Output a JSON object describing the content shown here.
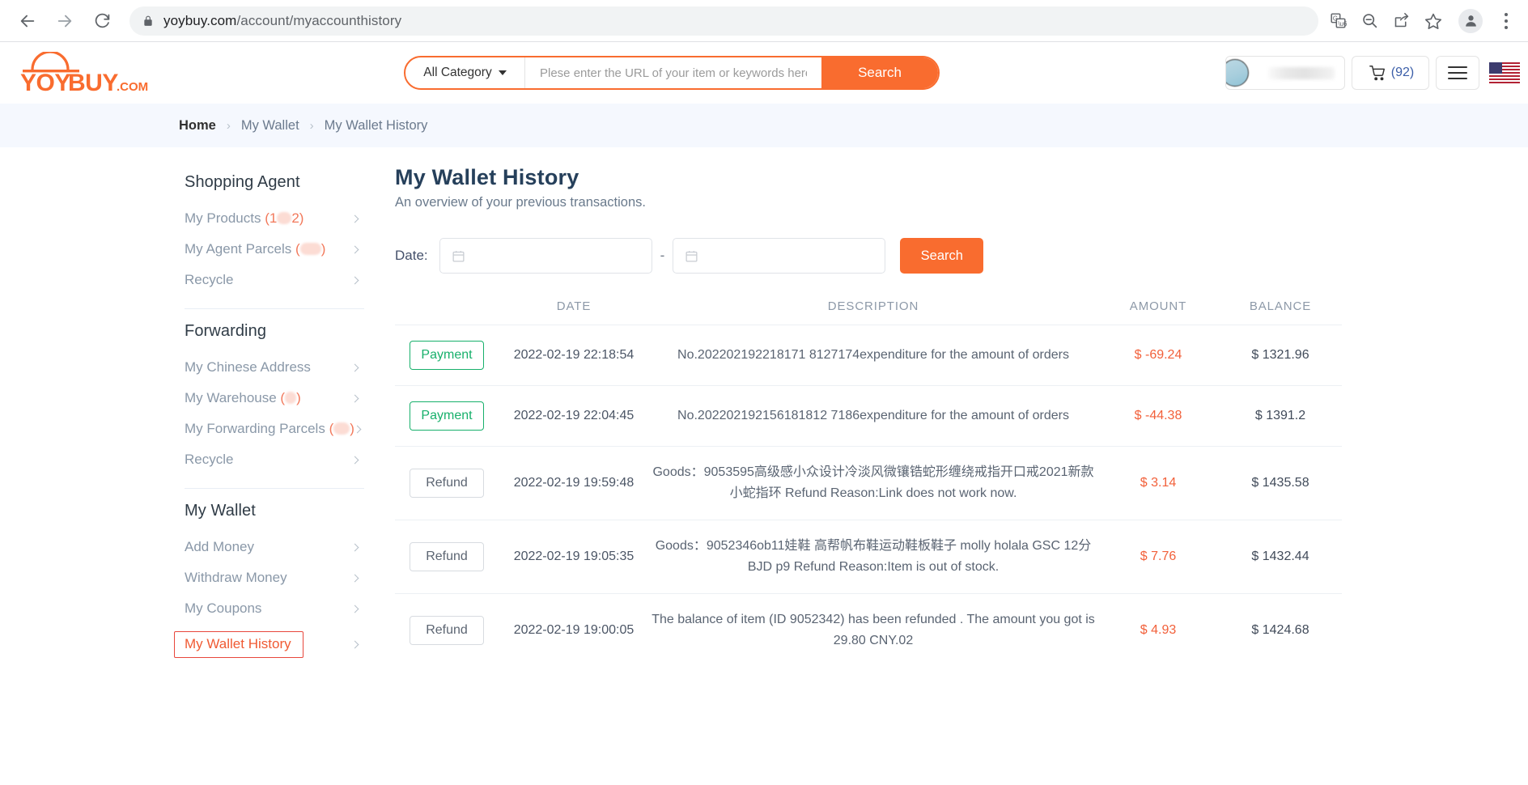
{
  "browser": {
    "url_domain": "yoybuy.com",
    "url_path": "/account/myaccounthistory",
    "back_icon": "back-arrow-icon",
    "forward_icon": "forward-arrow-icon",
    "reload_icon": "reload-icon",
    "lock_icon": "lock-icon",
    "translate_icon": "translate-icon",
    "zoom_out_icon": "zoom-out-icon",
    "share_icon": "share-icon",
    "bookmark_icon": "star-icon",
    "profile_icon": "profile-avatar-icon",
    "menu_icon": "kebab-menu-icon"
  },
  "header": {
    "logo_text": "YOYBUY.COM",
    "category_label": "All Category",
    "search_placeholder": "Plese enter the URL of your item or keywords here...",
    "search_value": "",
    "search_button": "Search",
    "cart_count": "(92)",
    "flag": "us-flag-icon",
    "account_name": ""
  },
  "breadcrumb": {
    "home": "Home",
    "parent": "My Wallet",
    "current": "My Wallet History",
    "separator": "›"
  },
  "sidebar": {
    "groups": [
      {
        "title": "Shopping Agent",
        "items": [
          {
            "label": "My Products",
            "count_prefix": "(1",
            "count_suffix": "2)",
            "redacted": true,
            "redact_w": 18,
            "active": false
          },
          {
            "label": "My Agent Parcels",
            "count_prefix": "(",
            "count_suffix": ")",
            "redacted": true,
            "redact_w": 26,
            "active": false
          },
          {
            "label": "Recycle",
            "count_prefix": "",
            "count_suffix": "",
            "redacted": false,
            "redact_w": 0,
            "active": false
          }
        ]
      },
      {
        "title": "Forwarding",
        "items": [
          {
            "label": "My Chinese Address",
            "count_prefix": "",
            "count_suffix": "",
            "redacted": false,
            "redact_w": 0,
            "active": false
          },
          {
            "label": "My Warehouse",
            "count_prefix": "(",
            "count_suffix": ")",
            "redacted": true,
            "redact_w": 14,
            "active": false
          },
          {
            "label": "My Forwarding Parcels",
            "count_prefix": "(",
            "count_suffix": ")",
            "redacted": true,
            "redact_w": 20,
            "active": false
          },
          {
            "label": "Recycle",
            "count_prefix": "",
            "count_suffix": "",
            "redacted": false,
            "redact_w": 0,
            "active": false
          }
        ]
      },
      {
        "title": "My Wallet",
        "items": [
          {
            "label": "Add Money",
            "count_prefix": "",
            "count_suffix": "",
            "redacted": false,
            "redact_w": 0,
            "active": false
          },
          {
            "label": "Withdraw Money",
            "count_prefix": "",
            "count_suffix": "",
            "redacted": false,
            "redact_w": 0,
            "active": false
          },
          {
            "label": "My Coupons",
            "count_prefix": "",
            "count_suffix": "",
            "redacted": false,
            "redact_w": 0,
            "active": false
          },
          {
            "label": "My Wallet History",
            "count_prefix": "",
            "count_suffix": "",
            "redacted": false,
            "redact_w": 0,
            "active": true
          }
        ]
      }
    ]
  },
  "main": {
    "title": "My Wallet History",
    "subtitle": "An overview of your previous transactions.",
    "filter": {
      "date_label": "Date:",
      "date_from_value": "",
      "date_to_value": "",
      "date_placeholder": "",
      "separator": "-",
      "search_button": "Search",
      "calendar_icon": "calendar-icon"
    },
    "table": {
      "columns": [
        "",
        "DATE",
        "DESCRIPTION",
        "AMOUNT",
        "BALANCE"
      ],
      "rows": [
        {
          "type": "Payment",
          "date": "2022-02-19 22:18:54",
          "description": "No.202202192218171 8127174expenditure for the amount of orders",
          "amount": "$ -69.24",
          "balance": "$ 1321.96"
        },
        {
          "type": "Payment",
          "date": "2022-02-19 22:04:45",
          "description": "No.202202192156181812 7186expenditure for the amount of orders",
          "amount": "$ -44.38",
          "balance": "$ 1391.2"
        },
        {
          "type": "Refund",
          "date": "2022-02-19 19:59:48",
          "description": "Goods：9053595高级感小众设计冷淡风微镶锆蛇形缠绕戒指开口戒2021新款小蛇指环 Refund Reason:Link does not work now.",
          "amount": "$ 3.14",
          "balance": "$ 1435.58"
        },
        {
          "type": "Refund",
          "date": "2022-02-19 19:05:35",
          "description": "Goods：9052346ob11娃鞋 高帮帆布鞋运动鞋板鞋子 molly holala GSC 12分BJD p9 Refund Reason:Item is out of stock.",
          "amount": "$ 7.76",
          "balance": "$ 1432.44"
        },
        {
          "type": "Refund",
          "date": "2022-02-19 19:00:05",
          "description": "The balance of item (ID 9052342) has been refunded . The amount you got is 29.80 CNY.02",
          "amount": "$ 4.93",
          "balance": "$ 1424.68"
        }
      ]
    }
  }
}
